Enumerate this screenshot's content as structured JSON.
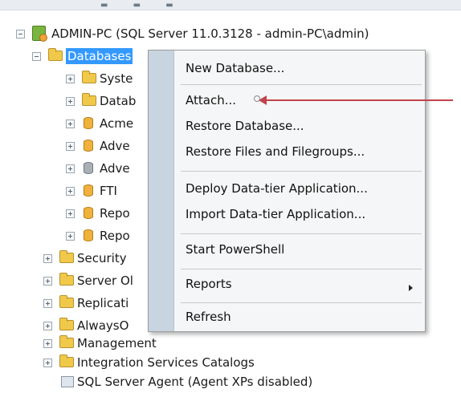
{
  "colors": {
    "selection": "#3399ff",
    "menu_gutter": "#c8d4e0",
    "annotation_arrow": "#c0444a"
  },
  "tree": {
    "server": {
      "label": "ADMIN-PC (SQL Server 11.0.3128 - admin-PC\\admin)",
      "icon": "server-icon"
    },
    "databases": {
      "label": "Databases",
      "icon": "folder-icon"
    },
    "children": [
      {
        "label": "Syste",
        "icon": "folder-icon"
      },
      {
        "label": "Datab",
        "icon": "folder-icon"
      },
      {
        "label": "Acme",
        "icon": "database-icon"
      },
      {
        "label": "Adve",
        "icon": "database-icon"
      },
      {
        "label": "Adve",
        "icon": "database-offline-icon"
      },
      {
        "label": "FTI",
        "icon": "database-icon"
      },
      {
        "label": "Repo",
        "icon": "database-icon"
      },
      {
        "label": "Repo",
        "icon": "database-icon"
      }
    ],
    "folders": [
      {
        "label": "Security"
      },
      {
        "label": "Server Ol"
      },
      {
        "label": "Replicati"
      },
      {
        "label": "AlwaysO"
      },
      {
        "label": "Management"
      },
      {
        "label": "Integration Services Catalogs"
      }
    ],
    "agent": {
      "label": "SQL Server Agent (Agent XPs disabled)",
      "icon": "agent-icon"
    }
  },
  "context_menu": {
    "items": [
      {
        "label": "New Database..."
      },
      {
        "label": "Attach..."
      },
      {
        "label": "Restore Database..."
      },
      {
        "label": "Restore Files and Filegroups..."
      },
      {
        "label": "Deploy Data-tier Application..."
      },
      {
        "label": "Import Data-tier Application..."
      },
      {
        "label": "Start PowerShell"
      },
      {
        "label": "Reports"
      },
      {
        "label": "Refresh"
      }
    ]
  }
}
